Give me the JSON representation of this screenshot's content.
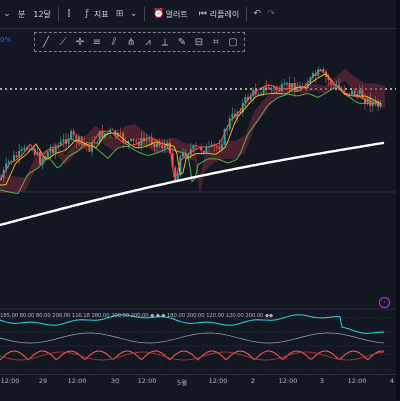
{
  "toolbar": {
    "interval_label": "분",
    "interval_value": "12달",
    "indicators_label": "지표",
    "alert_label": "얼러트",
    "replay_label": "리플레이",
    "icons": [
      "chevron-down-icon",
      "bar-style-icon",
      "indicators-icon",
      "layout-icon",
      "alert-icon",
      "replay-icon",
      "undo-icon",
      "redo-icon"
    ]
  },
  "drawing_toolbar": {
    "icons": [
      "trend-line-icon",
      "ray-icon",
      "cross-icon",
      "fib-icon",
      "channel-icon",
      "pitchfork-icon",
      "pattern-icon",
      "projection-icon",
      "brush-icon",
      "text-icon",
      "measure-icon",
      "frame-icon"
    ]
  },
  "side_label": "0%",
  "oscillator_badges": "185.00 80.00 80.00 200.00 116.18 280.00 200.00 200.00 ◆ ◆ ◆ 180.00 200.00 120.00 120.00 200.00 ◆◆",
  "colors": {
    "background": "#131722",
    "candle_up": "#26a69a",
    "candle_down": "#ef5350",
    "ma_white": "#ffffff",
    "ma_red": "#ef5350",
    "ma_green": "#4caf50",
    "ma_yellow": "#f5c518",
    "cloud": "#7b2a3a",
    "oscillator_cyan": "#26c6da",
    "oscillator_red": "#ef5350"
  },
  "x_axis": {
    "labels": [
      "12:00",
      "29",
      "12:00",
      "30",
      "12:00",
      "5월",
      "12:00",
      "2",
      "12:00",
      "3",
      "12:00",
      "4"
    ]
  }
}
